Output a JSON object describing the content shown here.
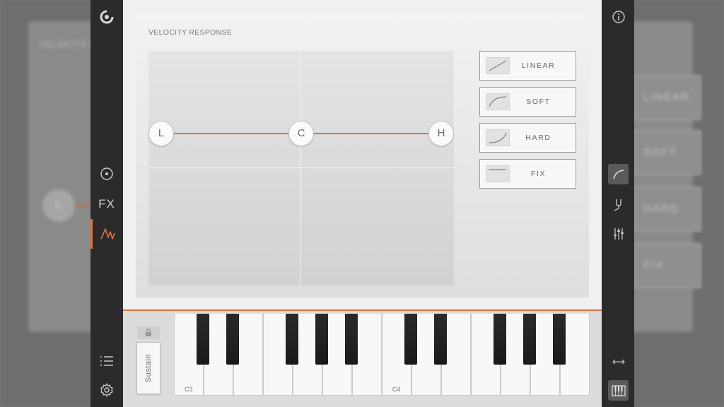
{
  "background": {
    "title": "VELOCITY RESPONSE",
    "knob_label": "L",
    "buttons": [
      "LINEAR",
      "SOFT",
      "HARD",
      "FIX"
    ]
  },
  "left_sidebar": {
    "logo_icon": "app-logo-icon",
    "fx_label": "FX",
    "icons": [
      "circle-dot-icon",
      "waveform-icon",
      "list-icon",
      "gear-icon"
    ],
    "active_item": "waveform"
  },
  "velocity": {
    "title": "VELOCITY RESPONSE",
    "nodes": [
      {
        "label": "L"
      },
      {
        "label": "C"
      },
      {
        "label": "H"
      }
    ],
    "curve_color": "#e0703f",
    "buttons": [
      {
        "label": "LINEAR",
        "icon": "linear-curve-icon"
      },
      {
        "label": "SOFT",
        "icon": "soft-curve-icon"
      },
      {
        "label": "HARD",
        "icon": "hard-curve-icon"
      },
      {
        "label": "FIX",
        "icon": "fix-curve-icon"
      }
    ]
  },
  "keyboard": {
    "sustain_label": "Sustain",
    "lock_icon": "lock-icon",
    "octave_labels": [
      "C3",
      "C4"
    ],
    "white_key_count": 14
  },
  "right_sidebar": {
    "icons": [
      "info-icon",
      "velocity-curve-icon",
      "tuning-fork-icon",
      "sliders-icon",
      "expand-horizontal-icon",
      "piano-keys-icon"
    ],
    "selected": [
      "velocity-curve-icon",
      "piano-keys-icon"
    ]
  },
  "colors": {
    "accent": "#e0703f",
    "sidebar": "#2b2b2b",
    "panel": "#f0f0f0"
  }
}
